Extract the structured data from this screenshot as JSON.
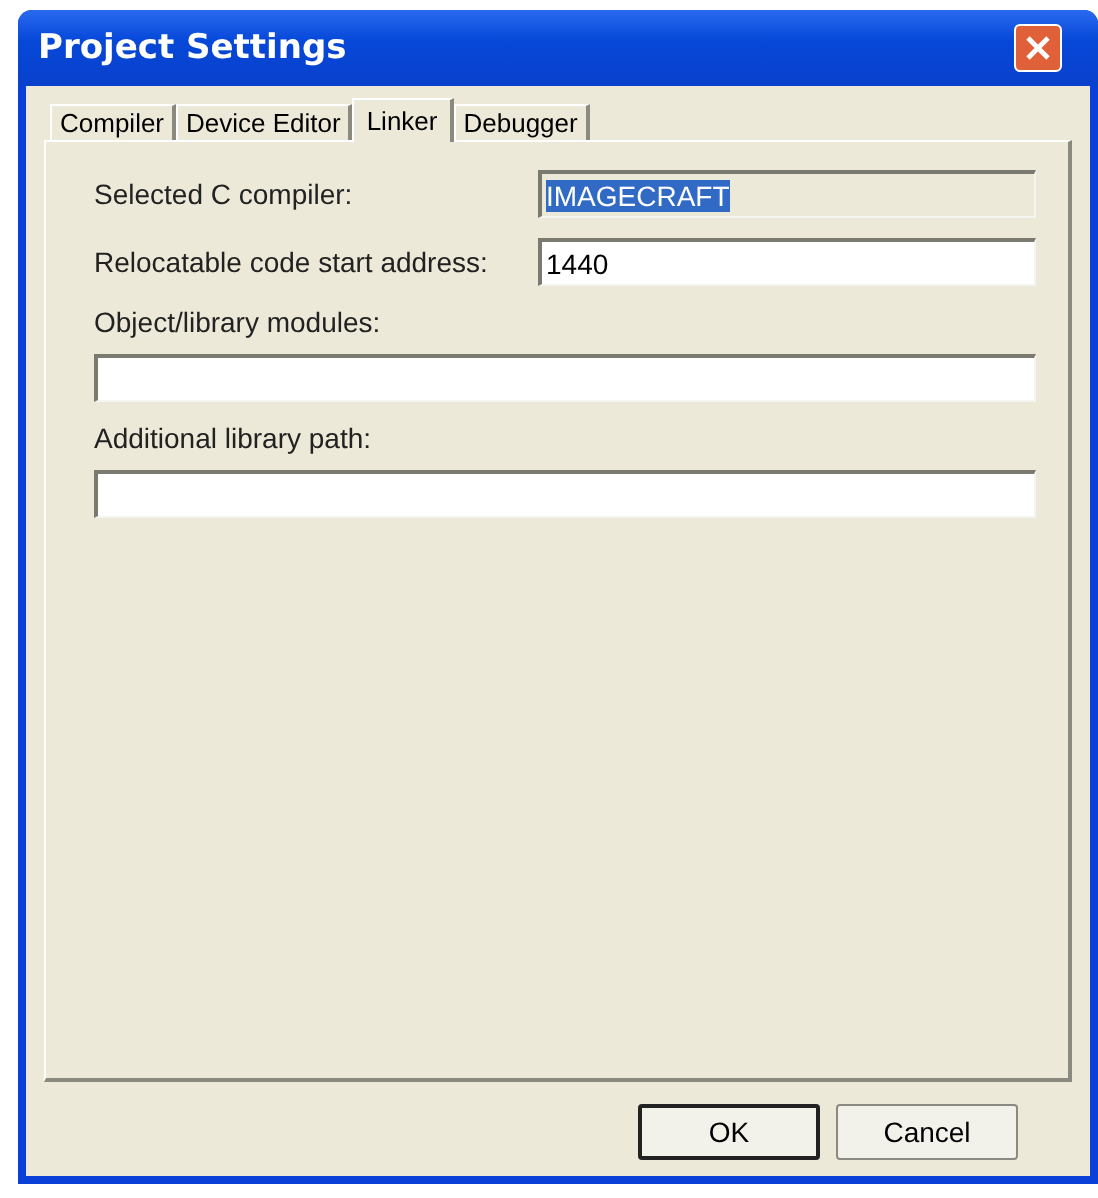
{
  "window": {
    "title": "Project Settings"
  },
  "tabs": [
    {
      "label": "Compiler",
      "selected": false
    },
    {
      "label": "Device Editor",
      "selected": false
    },
    {
      "label": "Linker",
      "selected": true
    },
    {
      "label": "Debugger",
      "selected": false
    }
  ],
  "fields": [
    {
      "kind": "inline",
      "label": "Selected C compiler:",
      "value": "IMAGECRAFT",
      "readonly": true,
      "highlighted": true
    },
    {
      "kind": "inline",
      "label": "Relocatable code start address:",
      "value": "1440",
      "readonly": false,
      "highlighted": false
    },
    {
      "kind": "stacked",
      "label": "Object/library modules:",
      "readonly": false
    },
    {
      "kind": "stacked",
      "label": "Additional library path:",
      "readonly": false
    }
  ],
  "buttons": [
    {
      "label": "OK",
      "default": true
    },
    {
      "label": "Cancel",
      "default": false
    }
  ]
}
